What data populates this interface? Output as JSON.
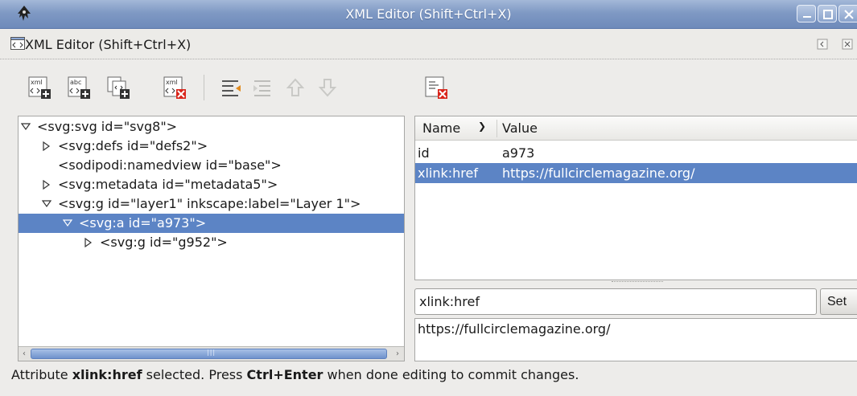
{
  "window": {
    "title": "XML Editor (Shift+Ctrl+X)",
    "app_icon": "inkscape-icon",
    "controls": [
      "minimize-icon",
      "maximize-icon",
      "close-icon"
    ]
  },
  "dock": {
    "title": "XML Editor (Shift+Ctrl+X)",
    "icon": "xml-editor-icon",
    "controls": [
      "dock-iconify-icon",
      "dock-close-icon"
    ]
  },
  "node_toolbar": {
    "buttons": [
      "new-element-node-icon",
      "new-text-node-icon",
      "duplicate-node-icon",
      "delete-node-icon",
      "unindent-node-icon",
      "indent-node-icon",
      "raise-node-icon",
      "lower-node-icon"
    ],
    "icon_text": {
      "xml": "xml",
      "abc": "abc"
    }
  },
  "tree": {
    "rows": [
      {
        "text": "<svg:svg id=\"svg8\">",
        "expander": "expanded"
      },
      {
        "text": "<svg:defs id=\"defs2\">",
        "expander": "collapsed"
      },
      {
        "text": "<sodipodi:namedview id=\"base\">",
        "expander": "none"
      },
      {
        "text": "<svg:metadata id=\"metadata5\">",
        "expander": "collapsed"
      },
      {
        "text": "<svg:g id=\"layer1\" inkscape:label=\"Layer 1\">",
        "expander": "expanded"
      },
      {
        "text": "<svg:a id=\"a973\">",
        "expander": "expanded",
        "selected": true
      },
      {
        "text": "<svg:g id=\"g952\">",
        "expander": "collapsed"
      }
    ]
  },
  "attr_toolbar": {
    "buttons": [
      "delete-attribute-icon"
    ]
  },
  "attributes": {
    "columns": {
      "name": "Name",
      "value": "Value"
    },
    "rows": [
      {
        "name": "id",
        "value": "a973"
      },
      {
        "name": "xlink:href",
        "value": "https://fullcirclemagazine.org/",
        "selected": true
      }
    ]
  },
  "editor": {
    "name_value": "xlink:href",
    "set_label": "Set",
    "value_text": "https://fullcirclemagazine.org/"
  },
  "status": {
    "part1": "Attribute ",
    "attr": "xlink:href",
    "part2": " selected. Press ",
    "keys": "Ctrl+Enter",
    "part3": " when done editing to commit changes."
  },
  "colors": {
    "selection": "#5c84c5",
    "titlebar": "#7f99c4",
    "delete_red": "#d9261c"
  }
}
